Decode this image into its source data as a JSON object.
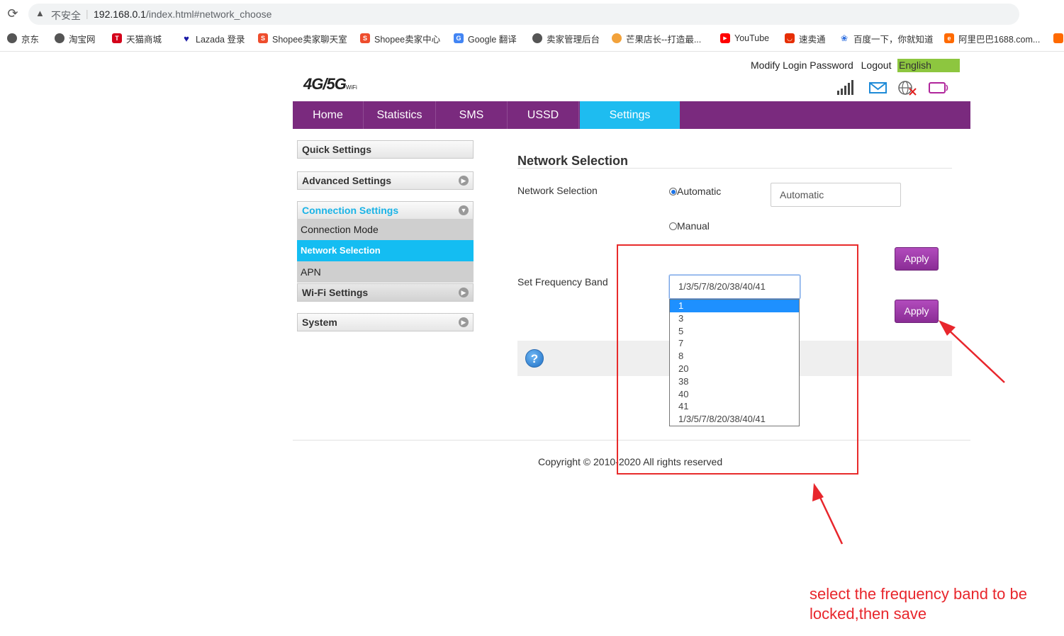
{
  "browser": {
    "reload_icon": "reload-icon",
    "warning_icon": "warning-triangle-icon",
    "security_label": "不安全",
    "separator": "|",
    "url_host": "192.168.0.1",
    "url_path": "/index.html#network_choose",
    "bookmarks": [
      {
        "label": "京东",
        "icon": "globe-icon",
        "color": "#555555"
      },
      {
        "label": "淘宝网",
        "icon": "globe-icon",
        "color": "#555555"
      },
      {
        "label": "天猫商城",
        "icon": "tmall-icon",
        "color": "#d4001a"
      },
      {
        "label": "Lazada 登录",
        "icon": "heart-icon",
        "color": "#1a1aa6"
      },
      {
        "label": "Shopee卖家聊天室",
        "icon": "shopee-bag-icon",
        "color": "#ee4d2d"
      },
      {
        "label": "Shopee卖家中心",
        "icon": "shopee-bag-icon",
        "color": "#ee4d2d"
      },
      {
        "label": "Google 翻译",
        "icon": "translate-icon",
        "color": "#4285f4"
      },
      {
        "label": "卖家管理后台",
        "icon": "globe-icon",
        "color": "#555555"
      },
      {
        "label": "芒果店长--打造最...",
        "icon": "mango-icon",
        "color": "#f2a23b"
      },
      {
        "label": "YouTube",
        "icon": "youtube-icon",
        "color": "#ff0000"
      },
      {
        "label": "速卖通",
        "icon": "aliexpress-icon",
        "color": "#e62e04"
      },
      {
        "label": "百度一下，你就知道",
        "icon": "baidu-paw-icon",
        "color": "#2f6fe0"
      },
      {
        "label": "阿里巴巴1688.com...",
        "icon": "alibaba-icon",
        "color": "#ff6a00"
      }
    ]
  },
  "header": {
    "logo_main": "4G/5G",
    "logo_sub": "WiFi",
    "links": [
      "Modify Login Password",
      "Logout"
    ],
    "language": "English",
    "language_color": "#8dc63f",
    "status_icons": [
      "signal-bars-icon",
      "mail-icon",
      "globe-disconnected-icon",
      "device-icon"
    ]
  },
  "nav": {
    "tabs": [
      "Home",
      "Statistics",
      "SMS",
      "USSD",
      "Settings"
    ],
    "active": "Settings",
    "bar_color": "#7a2a7e",
    "active_color": "#1ebcf0"
  },
  "sidebar": {
    "quick": "Quick Settings",
    "advanced": "Advanced Settings",
    "connection": "Connection Settings",
    "connection_items": [
      "Connection Mode",
      "Network Selection",
      "APN"
    ],
    "active_item": "Network Selection",
    "wifi": "Wi-Fi Settings",
    "system": "System"
  },
  "main": {
    "title": "Network Selection",
    "network_selection_label": "Network Selection",
    "radio_automatic": "Automatic",
    "radio_manual": "Manual",
    "selected_mode": "Automatic",
    "mode_display": "Automatic",
    "apply_label": "Apply",
    "band_label": "Set Frequency Band",
    "band_value": "1/3/5/7/8/20/38/40/41",
    "band_options": [
      "1",
      "3",
      "5",
      "7",
      "8",
      "20",
      "38",
      "40",
      "41",
      "1/3/5/7/8/20/38/40/41"
    ],
    "band_highlighted": "1",
    "help_symbol": "?"
  },
  "footer": {
    "copyright": "Copyright © 2010-2020 All rights reserved"
  },
  "annotation": {
    "note": "select the frequency band to be locked,then save",
    "color": "#e8262c"
  }
}
